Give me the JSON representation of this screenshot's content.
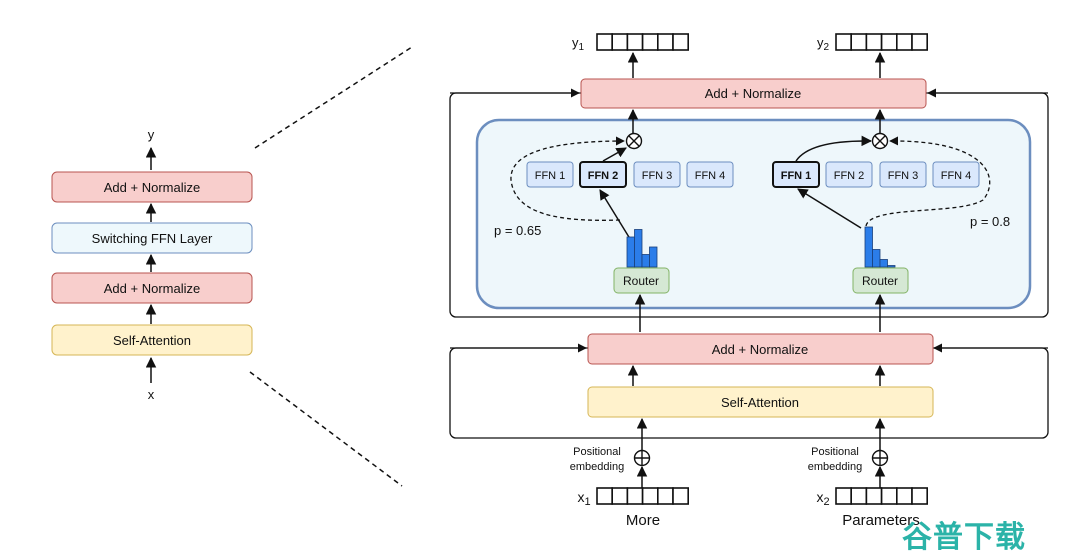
{
  "colors": {
    "norm_fill": "#f8cecc",
    "norm_stroke": "#b85450",
    "ffn_layer_fill": "#eef8fc",
    "ffn_layer_stroke": "#6c8ebf",
    "attn_fill": "#fff2cc",
    "attn_stroke": "#d6b656",
    "router_fill": "#d5e8d4",
    "router_stroke": "#82b366",
    "expert_fill": "#dae8fc",
    "expert_stroke": "#6c8ebf",
    "moe_bg": "#eef7fb",
    "moe_stroke": "#6c8ebf",
    "histogram": "#2b7de9",
    "watermark": "#2bb3a8"
  },
  "left_stack": {
    "output": "y",
    "input": "x",
    "add_norm_top": "Add + Normalize",
    "switching_ffn": "Switching FFN Layer",
    "add_norm_bottom": "Add + Normalize",
    "self_attention": "Self-Attention"
  },
  "right": {
    "outputs": [
      {
        "label": "y",
        "sub": "1"
      },
      {
        "label": "y",
        "sub": "2"
      }
    ],
    "inputs": [
      {
        "label": "x",
        "sub": "1",
        "word": "More"
      },
      {
        "label": "x",
        "sub": "2",
        "word": "Parameters"
      }
    ],
    "add_norm_top": "Add + Normalize",
    "add_norm_bottom": "Add + Normalize",
    "self_attention": "Self-Attention",
    "positional_embedding": [
      "Positional",
      "embedding"
    ],
    "router": "Router",
    "tokens": [
      {
        "experts": [
          "FFN 1",
          "FFN 2",
          "FFN 3",
          "FFN 4"
        ],
        "selected": 1,
        "probability": "p = 0.65",
        "router_histogram": [
          0.6,
          0.75,
          0.25,
          0.4
        ]
      },
      {
        "experts": [
          "FFN 1",
          "FFN 2",
          "FFN 3",
          "FFN 4"
        ],
        "selected": 0,
        "probability": "p = 0.8",
        "router_histogram": [
          0.8,
          0.35,
          0.15,
          0.03
        ]
      }
    ]
  },
  "watermark": "谷普下载"
}
